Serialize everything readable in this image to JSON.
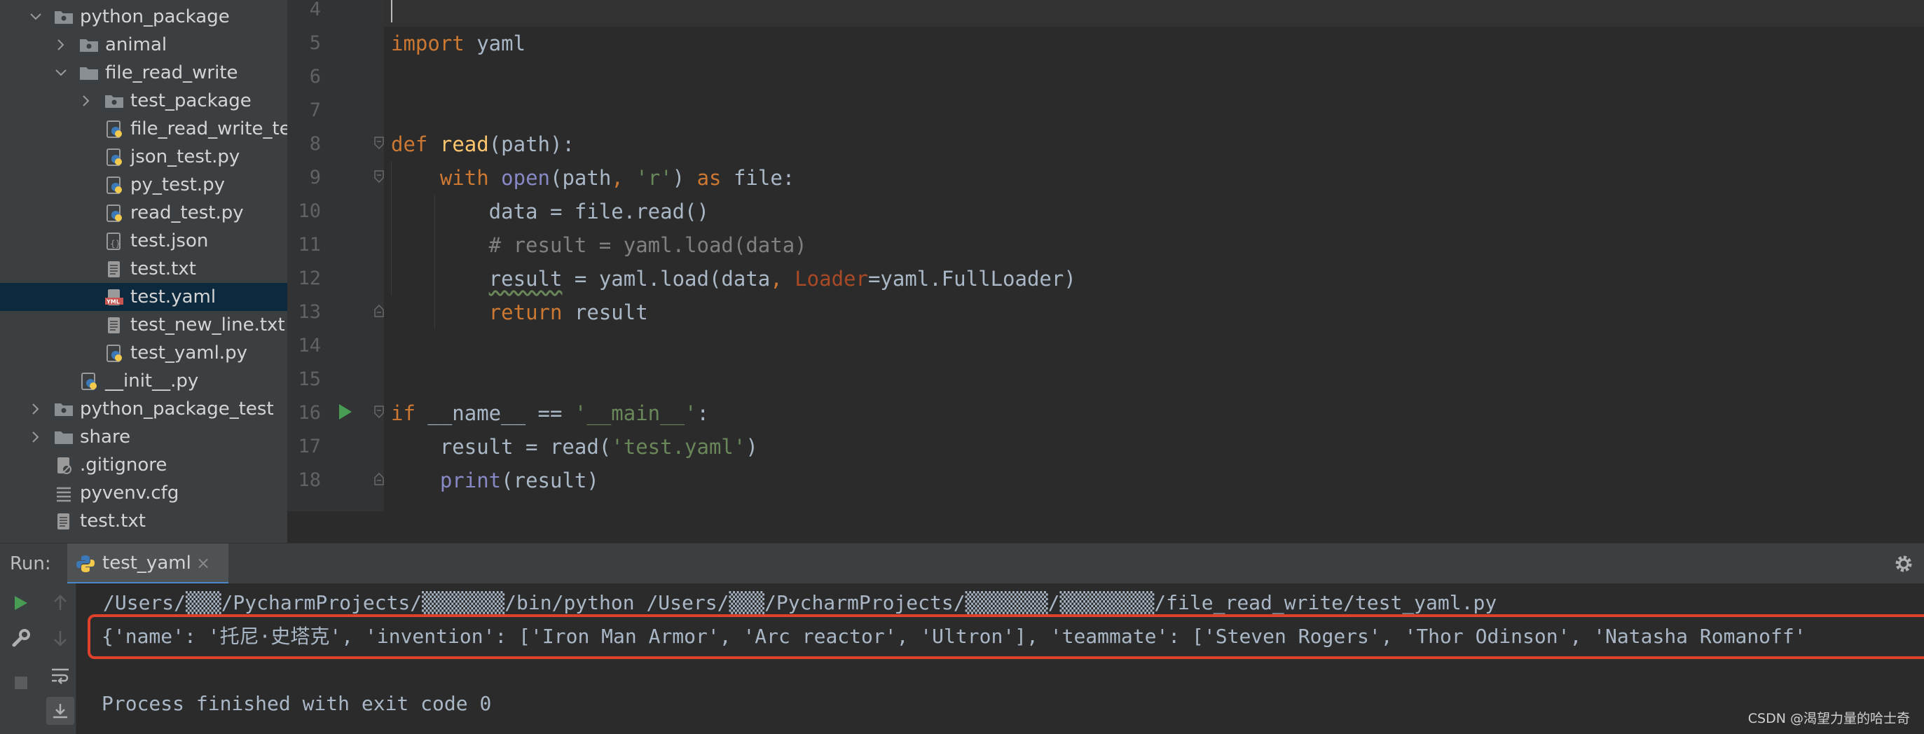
{
  "project_tree": {
    "items": [
      {
        "label": "python_package",
        "type": "package-folder",
        "expanded": true
      },
      {
        "label": "animal",
        "type": "package-folder",
        "expanded": false
      },
      {
        "label": "file_read_write",
        "type": "folder",
        "expanded": true
      },
      {
        "label": "test_package",
        "type": "package-folder",
        "expanded": false
      },
      {
        "label": "file_read_write_te",
        "type": "python-file"
      },
      {
        "label": "json_test.py",
        "type": "python-file"
      },
      {
        "label": "py_test.py",
        "type": "python-file"
      },
      {
        "label": "read_test.py",
        "type": "python-file"
      },
      {
        "label": "test.json",
        "type": "json-file"
      },
      {
        "label": "test.txt",
        "type": "text-file"
      },
      {
        "label": "test.yaml",
        "type": "yaml-file",
        "selected": true
      },
      {
        "label": "test_new_line.txt",
        "type": "text-file"
      },
      {
        "label": "test_yaml.py",
        "type": "python-file"
      },
      {
        "label": "__init__.py",
        "type": "python-file"
      },
      {
        "label": "python_package_test",
        "type": "package-folder",
        "expanded": false
      },
      {
        "label": "share",
        "type": "folder",
        "expanded": false
      },
      {
        "label": ".gitignore",
        "type": "git-file"
      },
      {
        "label": "pyvenv.cfg",
        "type": "config-file"
      },
      {
        "label": "test.txt",
        "type": "text-file"
      }
    ]
  },
  "editor": {
    "line_numbers": [
      "4",
      "5",
      "6",
      "7",
      "8",
      "9",
      "10",
      "11",
      "12",
      "13",
      "14",
      "15",
      "16",
      "17",
      "18"
    ],
    "code": {
      "l5_kw": "import",
      "l5_rest": " yaml",
      "l8_kw": "def",
      "l8_fn": "read",
      "l8_rest": "(path):",
      "l9_indent": "    ",
      "l9_kw": "with",
      "l9_sp": " ",
      "l9_bi": "open",
      "l9_a": "(path",
      "l9_comma": ",",
      "l9_sp2": " ",
      "l9_str": "'r'",
      "l9_b": ") ",
      "l9_as": "as",
      "l9_c": " file:",
      "l10": "        data = file.read()",
      "l11": "        # result = yaml.load(data)",
      "l12_indent": "        ",
      "l12_var": "result",
      "l12_a": " = yaml.load(data",
      "l12_comma": ",",
      "l12_sp": " ",
      "l12_param": "Loader",
      "l12_b": "=yaml.FullLoader)",
      "l13_indent": "        ",
      "l13_kw": "return",
      "l13_rest": " result",
      "l16_kw": "if",
      "l16_a": " __name__ == ",
      "l16_str": "'__main__'",
      "l16_b": ":",
      "l17_a": "    result = read(",
      "l17_str": "'test.yaml'",
      "l17_b": ")",
      "l18_indent": "    ",
      "l18_bi": "print",
      "l18_rest": "(result)"
    }
  },
  "run_panel": {
    "label": "Run:",
    "tab_label": "test_yaml",
    "tab_close": "×",
    "console_lines": {
      "command": "/Users/▒▒▒/PycharmProjects/▒▒▒▒▒▒▒/bin/python /Users/▒▒▒/PycharmProjects/▒▒▒▒▒▒▒/▒▒▒▒▒▒▒▒/file_read_write/test_yaml.py",
      "output": "{'name': '托尼·史塔克', 'invention': ['Iron Man Armor', 'Arc reactor', 'Ultron'], 'teammate': ['Steven Rogers', 'Thor Odinson', 'Natasha Romanoff'",
      "blank": "",
      "exit": "Process finished with exit code 0"
    }
  },
  "watermark": "CSDN @渴望力量的哈士奇",
  "colors": {
    "keyword": "#cc7832",
    "function": "#ffc66d",
    "string": "#6a8759",
    "comment": "#808080",
    "highlight_box": "#e0412b",
    "run_green": "#499c54"
  }
}
